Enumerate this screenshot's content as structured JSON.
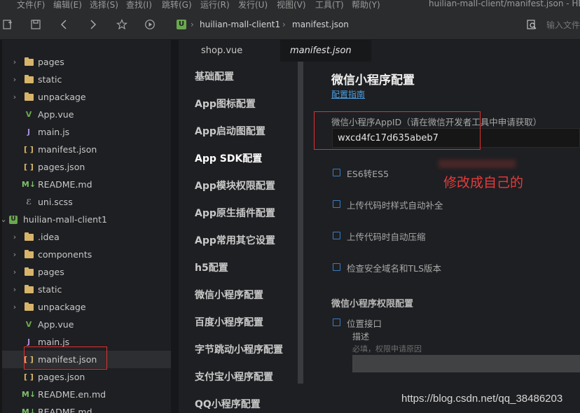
{
  "menubar": {
    "items": [
      "文件(F)",
      "编辑(E)",
      "选择(S)",
      "查找(I)",
      "跳转(G)",
      "运行(R)",
      "发行(U)",
      "视图(V)",
      "工具(T)",
      "帮助(Y)"
    ],
    "window_title": "huilian-mall-client/manifest.json - HBu"
  },
  "toolbar": {
    "breadcrumb": [
      "huilian-mall-client1",
      "manifest.json"
    ],
    "search_placeholder": "输入文件"
  },
  "sidebar": {
    "items": [
      {
        "label": "pages",
        "kind": "folder"
      },
      {
        "label": "static",
        "kind": "folder"
      },
      {
        "label": "unpackage",
        "kind": "folder"
      },
      {
        "label": "App.vue",
        "kind": "vue"
      },
      {
        "label": "main.js",
        "kind": "js"
      },
      {
        "label": "manifest.json",
        "kind": "json"
      },
      {
        "label": "pages.json",
        "kind": "json"
      },
      {
        "label": "README.md",
        "kind": "md"
      },
      {
        "label": "uni.scss",
        "kind": "scss"
      },
      {
        "label": "huilian-mall-client1",
        "kind": "project"
      },
      {
        "label": ".idea",
        "kind": "folder"
      },
      {
        "label": "components",
        "kind": "folder"
      },
      {
        "label": "pages",
        "kind": "folder"
      },
      {
        "label": "static",
        "kind": "folder"
      },
      {
        "label": "unpackage",
        "kind": "folder"
      },
      {
        "label": "App.vue",
        "kind": "vue"
      },
      {
        "label": "main.js",
        "kind": "js"
      },
      {
        "label": "manifest.json",
        "kind": "json"
      },
      {
        "label": "pages.json",
        "kind": "json"
      },
      {
        "label": "README.en.md",
        "kind": "md"
      },
      {
        "label": "README.md",
        "kind": "md"
      }
    ]
  },
  "tabs": [
    {
      "label": "shop.vue"
    },
    {
      "label": "manifest.json"
    }
  ],
  "config_nav": {
    "items": [
      "基础配置",
      "App图标配置",
      "App启动图配置",
      "App SDK配置",
      "App模块权限配置",
      "App原生插件配置",
      "App常用其它设置",
      "h5配置",
      "微信小程序配置",
      "百度小程序配置",
      "字节跳动小程序配置",
      "支付宝小程序配置",
      "QQ小程序配置"
    ]
  },
  "content": {
    "title": "微信小程序配置",
    "guide_link": "配置指南",
    "appid_label": "微信小程序AppID（请在微信开发者工具中申请获取）",
    "appid_value": "wxcd4fc17d635abeb7",
    "options": [
      "ES6转ES5",
      "上传代码时样式自动补全",
      "上传代码时自动压缩",
      "检查安全域名和TLS版本"
    ],
    "permissions_title": "微信小程序权限配置",
    "location_label": "位置接口",
    "desc_label": "描述",
    "desc_hint": "必填，权限申请原因"
  },
  "annotation": {
    "note": "修改成自己的",
    "color": "#e03030"
  },
  "watermark": "https://blog.csdn.net/qq_38486203",
  "colors": {
    "link": "#4a9fe3",
    "checkbox": "#3c7dc4",
    "folder": "#d7b46a",
    "project": "#6aa84f"
  }
}
